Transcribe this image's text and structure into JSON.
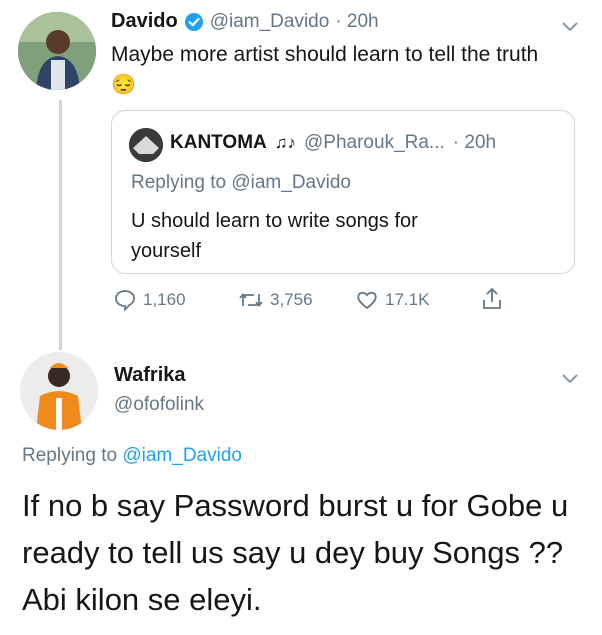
{
  "tweet": {
    "author_name": "Davido",
    "author_handle": "@iam_Davido",
    "time": "· 20h",
    "text": "Maybe more artist should learn to tell the truth",
    "emoji": "😔",
    "quote": {
      "author_name": "KANTOMA",
      "author_emoji": "♫♪",
      "author_handle": "@Pharouk_Ra...",
      "time": "· 20h",
      "replying_label": "Replying to",
      "replying_to": "@iam_Davido",
      "text_line1": "U should learn to write songs for",
      "text_line2": "yourself"
    },
    "actions": {
      "replies": "1,160",
      "retweets": "3,756",
      "likes": "17.1K"
    }
  },
  "reply": {
    "author_name": "Wafrika",
    "author_handle": "@ofofolink",
    "replying_label": "Replying to",
    "replying_to": "@iam_Davido",
    "text_line1": "If no b say Password burst u for Gobe u",
    "text_line2": "ready to tell us say u dey buy Songs ??",
    "text_line3": "Abi kilon se eleyi."
  },
  "colors": {
    "accent": "#1da1f2",
    "muted": "#657786",
    "border": "#ccd6dd"
  }
}
